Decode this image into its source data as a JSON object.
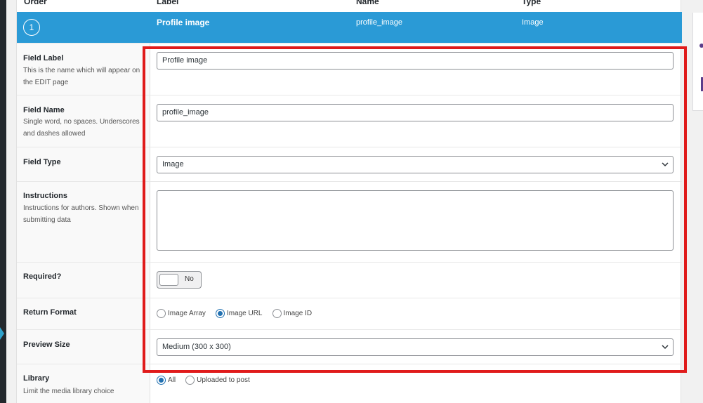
{
  "columns": {
    "order": "Order",
    "label": "Label",
    "name": "Name",
    "type": "Type"
  },
  "field": {
    "order": "1",
    "label": "Profile image",
    "name": "profile_image",
    "type": "Image"
  },
  "rows": {
    "field_label": {
      "label": "Field Label",
      "desc": "This is the name which will appear on the EDIT page",
      "value": "Profile image"
    },
    "field_name": {
      "label": "Field Name",
      "desc": "Single word, no spaces. Underscores and dashes allowed",
      "value": "profile_image"
    },
    "field_type": {
      "label": "Field Type",
      "value": "Image"
    },
    "instructions": {
      "label": "Instructions",
      "desc": "Instructions for authors. Shown when submitting data",
      "value": ""
    },
    "required": {
      "label": "Required?",
      "toggle_text": "No"
    },
    "return_format": {
      "label": "Return Format",
      "options": [
        "Image Array",
        "Image URL",
        "Image ID"
      ],
      "selected": "Image URL"
    },
    "preview_size": {
      "label": "Preview Size",
      "value": "Medium (300 x 300)"
    },
    "library": {
      "label": "Library",
      "desc": "Limit the media library choice",
      "options": [
        "All",
        "Uploaded to post"
      ],
      "selected": "All"
    }
  },
  "colors": {
    "accent": "#2a9ad6",
    "highlight": "#e01b1b",
    "radio": "#2271b1"
  }
}
